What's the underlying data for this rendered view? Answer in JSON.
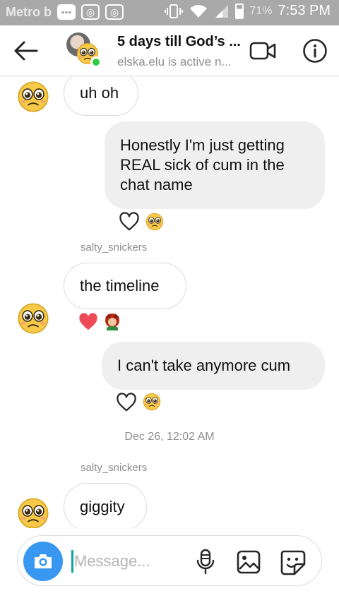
{
  "status_bar": {
    "carrier": "Metro b",
    "notification_icons": [
      "more-icon",
      "instagram-icon",
      "instagram-icon"
    ],
    "battery_percent": "71%",
    "time": "7:53 PM"
  },
  "header": {
    "title": "5 days till God’s ...",
    "subtitle": "elska.elu is active n..."
  },
  "messages": [
    {
      "type": "incoming",
      "text": "uh oh"
    },
    {
      "type": "outgoing",
      "text": "Honestly I'm just getting REAL sick of cum in the chat name"
    },
    {
      "type": "incoming",
      "sender": "salty_snickers",
      "text": "the timeline"
    },
    {
      "type": "outgoing",
      "text": "I can't take anymore cum"
    },
    {
      "type": "timestamp",
      "text": "Dec 26, 12:02 AM"
    },
    {
      "type": "incoming",
      "sender": "salty_snickers",
      "text": "giggity"
    }
  ],
  "composer": {
    "placeholder": "Message..."
  },
  "colors": {
    "accent_blue": "#3897f0",
    "active_green": "#2ecc40",
    "heart_red": "#ed4956",
    "outgoing_bubble": "#efefef"
  }
}
